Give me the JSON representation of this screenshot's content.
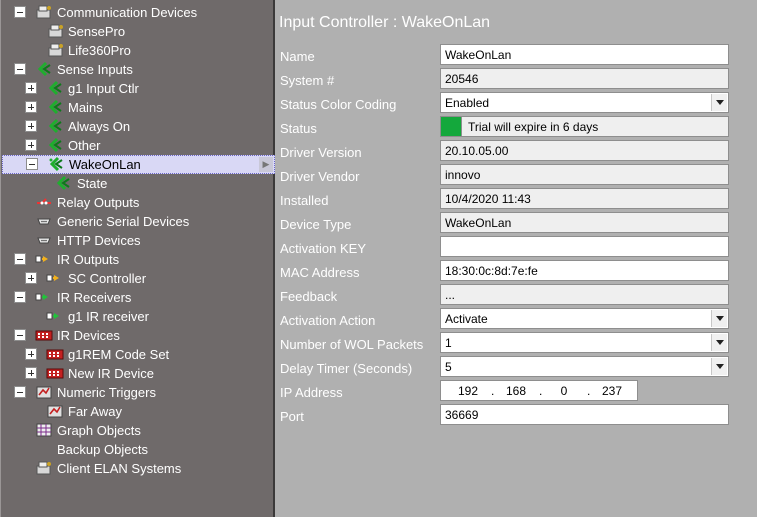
{
  "tree": {
    "nodes": [
      {
        "label": "Communication Devices",
        "toggle": "minus",
        "icon": "comm-devices-icon"
      },
      {
        "label": "SensePro",
        "toggle": null,
        "icon": "sense-device-icon"
      },
      {
        "label": "Life360Pro",
        "toggle": null,
        "icon": "sense-device-icon"
      },
      {
        "label": "Sense Inputs",
        "toggle": "minus",
        "icon": "sense-input-icon"
      },
      {
        "label": "g1 Input Ctlr",
        "toggle": "plus",
        "icon": "sense-input-icon"
      },
      {
        "label": "Mains",
        "toggle": "plus",
        "icon": "sense-input-icon"
      },
      {
        "label": "Always On",
        "toggle": "plus",
        "icon": "sense-input-icon"
      },
      {
        "label": "Other",
        "toggle": "plus",
        "icon": "sense-input-icon"
      },
      {
        "label": "WakeOnLan",
        "toggle": "minus",
        "icon": "sense-input-icon"
      },
      {
        "label": "State",
        "toggle": null,
        "icon": "sense-input-icon"
      },
      {
        "label": "Relay Outputs",
        "toggle": null,
        "icon": "relay-icon"
      },
      {
        "label": "Generic Serial Devices",
        "toggle": null,
        "icon": "serial-icon"
      },
      {
        "label": "HTTP Devices",
        "toggle": null,
        "icon": "serial-icon"
      },
      {
        "label": "IR Outputs",
        "toggle": "minus",
        "icon": "ir-output-icon"
      },
      {
        "label": "SC Controller",
        "toggle": "plus",
        "icon": "ir-output-icon"
      },
      {
        "label": "IR Receivers",
        "toggle": "minus",
        "icon": "ir-receiver-icon"
      },
      {
        "label": "g1 IR receiver",
        "toggle": null,
        "icon": "ir-receiver-icon"
      },
      {
        "label": "IR Devices",
        "toggle": "minus",
        "icon": "ir-device-icon"
      },
      {
        "label": "g1REM Code Set",
        "toggle": "plus",
        "icon": "ir-device-icon"
      },
      {
        "label": "New IR Device",
        "toggle": "plus",
        "icon": "ir-device-icon"
      },
      {
        "label": "Numeric Triggers",
        "toggle": "minus",
        "icon": "numeric-trigger-icon"
      },
      {
        "label": "Far Away",
        "toggle": null,
        "icon": "numeric-trigger-icon"
      },
      {
        "label": "Graph Objects",
        "toggle": null,
        "icon": "graph-icon"
      },
      {
        "label": "Backup Objects",
        "toggle": null,
        "icon": null
      },
      {
        "label": "Client ELAN Systems",
        "toggle": null,
        "icon": "comm-devices-icon"
      }
    ],
    "selected_index": 8
  },
  "panel": {
    "title": "Input Controller : WakeOnLan",
    "rows": [
      {
        "label": "Name",
        "value": "WakeOnLan",
        "kind": "text"
      },
      {
        "label": "System #",
        "value": "20546",
        "kind": "readonly"
      },
      {
        "label": "Status Color Coding",
        "value": "Enabled",
        "kind": "select"
      },
      {
        "label": "Status",
        "value": "Trial will expire in 6 days",
        "kind": "status"
      },
      {
        "label": "Driver Version",
        "value": "20.10.05.00",
        "kind": "readonly"
      },
      {
        "label": "Driver Vendor",
        "value": "innovo",
        "kind": "readonly"
      },
      {
        "label": "Installed",
        "value": "10/4/2020 11:43",
        "kind": "readonly"
      },
      {
        "label": "Device Type",
        "value": "WakeOnLan",
        "kind": "readonly"
      },
      {
        "label": "Activation KEY",
        "value": "",
        "kind": "text"
      },
      {
        "label": "MAC Address",
        "value": "18:30:0c:8d:7e:fe",
        "kind": "text"
      },
      {
        "label": "Feedback",
        "value": "...",
        "kind": "readonly"
      },
      {
        "label": "Activation Action",
        "value": "Activate",
        "kind": "select"
      },
      {
        "label": "Number of WOL Packets",
        "value": "1",
        "kind": "select"
      },
      {
        "label": "Delay Timer (Seconds)",
        "value": "5",
        "kind": "select"
      },
      {
        "label": "IP Address",
        "value": "",
        "kind": "ip"
      },
      {
        "label": "Port",
        "value": "36669",
        "kind": "text"
      }
    ],
    "ip_octets": [
      "192",
      "168",
      "0",
      "237"
    ],
    "status_color": "#14a83c"
  }
}
